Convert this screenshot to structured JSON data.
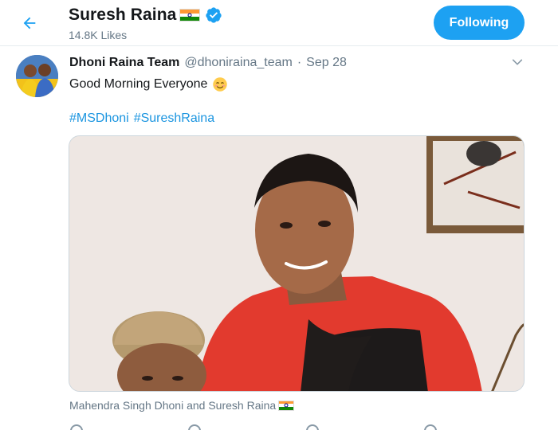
{
  "header": {
    "title": "Suresh Raina",
    "likes": "14.8K Likes",
    "follow_label": "Following",
    "accent": "#1da1f2"
  },
  "tweet": {
    "author_name": "Dhoni Raina Team",
    "handle": "@dhoniraina_team",
    "separator": "·",
    "date": "Sep 28",
    "text": "Good Morning Everyone",
    "emoji": "smiling-face-icon",
    "hashtags": [
      "#MSDhoni",
      "#SureshRaina"
    ],
    "hashtag_color": "#1b95e0",
    "media_caption": "Mahendra Singh Dhoni and Suresh Raina"
  },
  "icons": {
    "back": "arrow-left-icon",
    "verified": "verified-badge-icon",
    "caret": "chevron-down-icon",
    "flag": "india-flag-icon"
  }
}
